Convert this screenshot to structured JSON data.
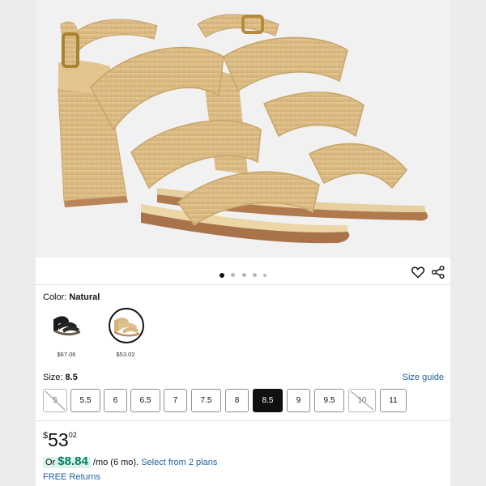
{
  "carousel": {
    "dot_count": 5,
    "active_index": 0
  },
  "actions": {
    "favorite_icon": "heart-icon",
    "share_icon": "share-icon"
  },
  "color": {
    "label": "Color:",
    "selected_name": "Natural",
    "swatches": [
      {
        "name": "black-sandal-swatch",
        "price": "$67.06",
        "selected": false
      },
      {
        "name": "natural-sandal-swatch",
        "price": "$53.02",
        "selected": true
      }
    ]
  },
  "size": {
    "label": "Size:",
    "selected": "8.5",
    "guide_link": "Size guide",
    "options": [
      {
        "label": "5",
        "state": "disabled"
      },
      {
        "label": "5.5",
        "state": "available"
      },
      {
        "label": "6",
        "state": "available"
      },
      {
        "label": "6.5",
        "state": "available"
      },
      {
        "label": "7",
        "state": "available"
      },
      {
        "label": "7.5",
        "state": "available"
      },
      {
        "label": "8",
        "state": "available"
      },
      {
        "label": "8.5",
        "state": "selected"
      },
      {
        "label": "9",
        "state": "available"
      },
      {
        "label": "9.5",
        "state": "available"
      },
      {
        "label": "10",
        "state": "disabled"
      },
      {
        "label": "11",
        "state": "available"
      }
    ]
  },
  "price": {
    "currency": "$",
    "whole": "53",
    "fraction": "02"
  },
  "installment": {
    "prefix": "Or",
    "amount": "$8.84",
    "term": "/mo (6 mo).",
    "link": "Select from 2 plans"
  },
  "returns": "FREE Returns",
  "colors": {
    "link": "#2162a1",
    "selected_size_bg": "#0f1111",
    "install_highlight": "#d9f4ea",
    "install_amount": "#067d62"
  }
}
